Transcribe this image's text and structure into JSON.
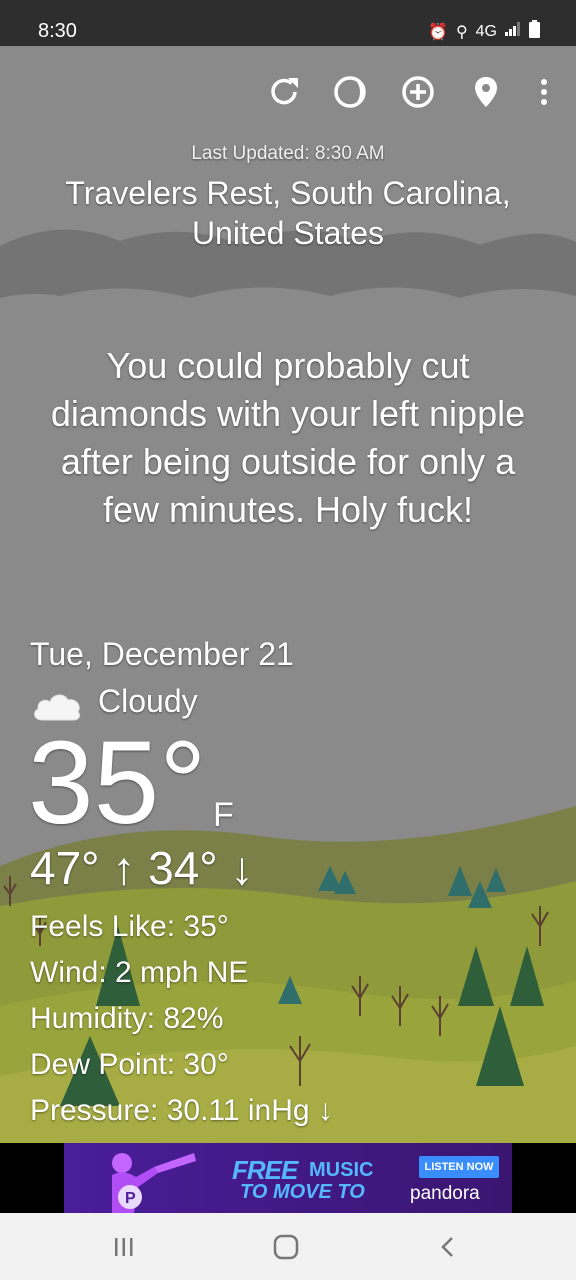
{
  "status": {
    "time": "8:30",
    "icons": [
      "alarm-icon",
      "location-icon",
      "4g-icon",
      "signal-icon",
      "battery-icon"
    ],
    "network": "4G"
  },
  "toolbar": {
    "icons": [
      "refresh-icon",
      "theme-icon",
      "add-location-icon",
      "location-pin-icon",
      "overflow-menu-icon"
    ]
  },
  "weather": {
    "last_updated": "Last Updated: 8:30 AM",
    "location": "Travelers Rest, South Carolina, United States",
    "quip": "You could probably cut diamonds with your left nipple after being outside for only a few minutes. Holy fuck!",
    "date": "Tue, December 21",
    "condition": "Cloudy",
    "temperature": "35°",
    "unit": "F",
    "hi_lo": "47° ↑ 34° ↓",
    "feels_like": "Feels Like:  35°",
    "wind": "Wind:  2 mph NE",
    "humidity": "Humidity:  82%",
    "dew_point": "Dew Point:  30°",
    "pressure": "Pressure:  30.11 inHg ↓"
  },
  "ad": {
    "free": "FREE",
    "music": "MUSIC",
    "move": "TO MOVE TO",
    "listen": "LISTEN NOW",
    "brand": "pandora"
  },
  "colors": {
    "sky": "#8a8a8a",
    "hill": "#8e9a3c",
    "tree": "#2f5e3a",
    "ad_bg": "#4a1d9a",
    "ad_accent": "#55b8ff"
  }
}
